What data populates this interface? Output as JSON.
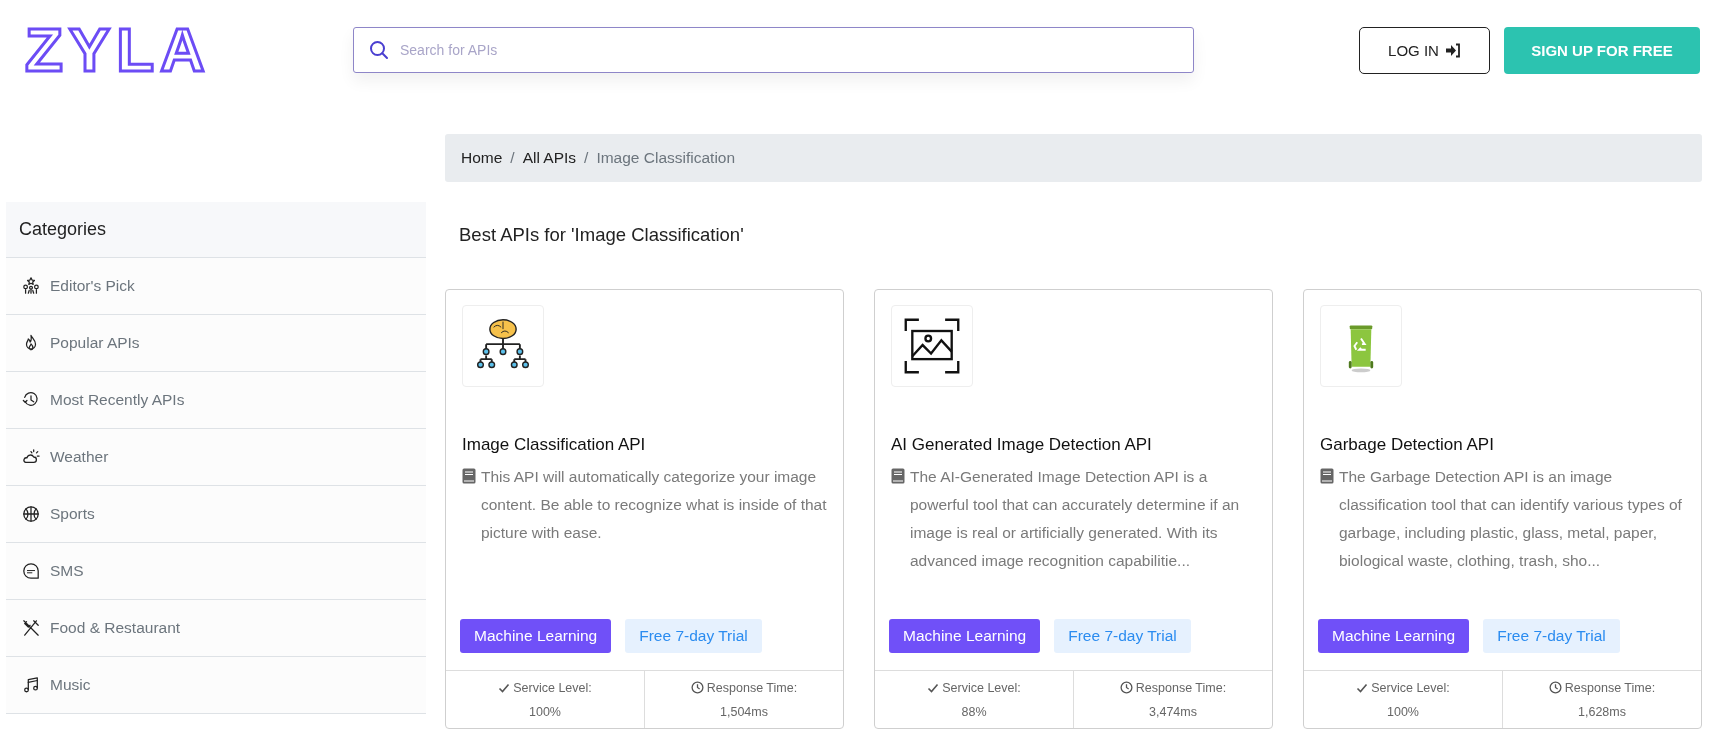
{
  "header": {
    "logo": "ZYLA",
    "search": {
      "placeholder": "Search for APIs"
    },
    "login_button": "LOG IN",
    "signup_button": "SIGN UP FOR FREE"
  },
  "breadcrumbs": {
    "separator": "/",
    "items": [
      {
        "label": "Home",
        "current": false
      },
      {
        "label": "All APIs",
        "current": false
      },
      {
        "label": "Image Classification",
        "current": true
      }
    ]
  },
  "sidebar": {
    "title": "Categories",
    "items": [
      {
        "label": "Editor's Pick",
        "kind": "stars"
      },
      {
        "label": "Popular APIs",
        "kind": "flame"
      },
      {
        "label": "Most Recently APIs",
        "kind": "history"
      },
      {
        "label": "Weather",
        "kind": "weather"
      },
      {
        "label": "Sports",
        "kind": "ball"
      },
      {
        "label": "SMS",
        "kind": "sms"
      },
      {
        "label": "Food & Restaurant",
        "kind": "food"
      },
      {
        "label": "Music",
        "kind": "music"
      }
    ]
  },
  "heading": "Best APIs for 'Image Classification'",
  "cards": [
    {
      "kind": "brain",
      "title": "Image Classification API",
      "description": "This API will automatically categorize your image content. Be able to recognize what is inside of that picture with ease.",
      "tags": [
        "Machine Learning",
        "Free 7-day Trial"
      ],
      "service_label": "Service Level:",
      "service_value": "100%",
      "response_label": "Response Time:",
      "response_value": "1,504ms"
    },
    {
      "kind": "image",
      "title": "AI Generated Image Detection API",
      "description": "The AI-Generated Image Detection API is a powerful tool that can accurately determine if an image is real or artificially generated. With its advanced image recognition capabilitie...",
      "tags": [
        "Machine Learning",
        "Free 7-day Trial"
      ],
      "service_label": "Service Level:",
      "service_value": "88%",
      "response_label": "Response Time:",
      "response_value": "3,474ms"
    },
    {
      "kind": "bin",
      "title": "Garbage Detection API",
      "description": "The Garbage Detection API is an image classification tool that can identify various types of garbage, including plastic, glass, metal, paper, biological waste, clothing, trash, sho...",
      "tags": [
        "Machine Learning",
        "Free 7-day Trial"
      ],
      "service_label": "Service Level:",
      "service_value": "100%",
      "response_label": "Response Time:",
      "response_value": "1,628ms"
    }
  ]
}
